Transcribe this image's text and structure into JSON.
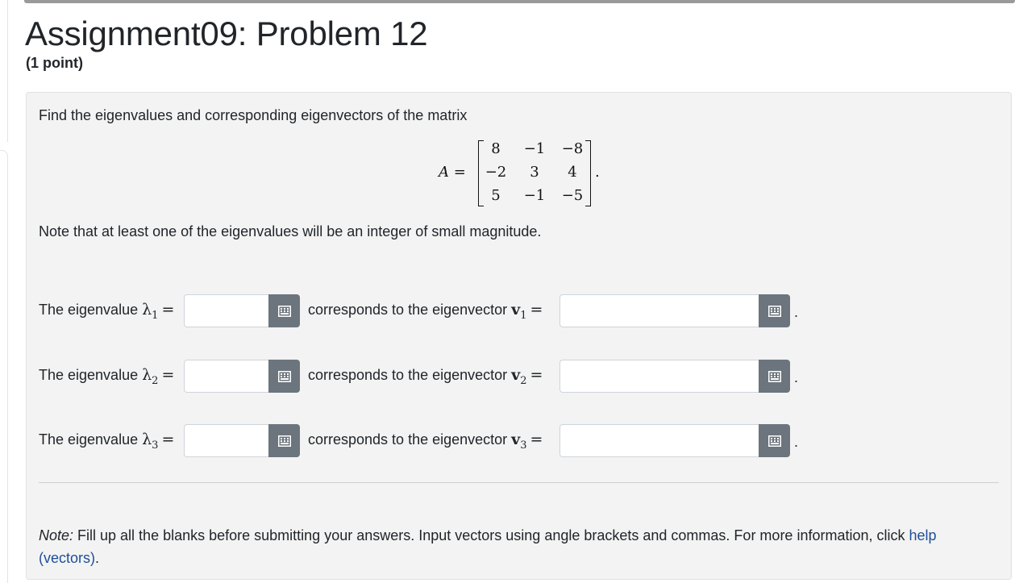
{
  "header": {
    "title": "Assignment09: Problem 12",
    "points": "(1 point)"
  },
  "problem": {
    "statement": "Find the eigenvalues and corresponding eigenvectors of the matrix",
    "matrix": {
      "name": "A",
      "eq": "=",
      "rows": [
        [
          "8",
          "−1",
          "−8"
        ],
        [
          "−2",
          "3",
          "4"
        ],
        [
          "5",
          "−1",
          "−5"
        ]
      ],
      "trailing": "."
    },
    "note": "Note that at least one of the eigenvalues will be an integer of small magnitude."
  },
  "answers": [
    {
      "eig_prefix": "The eigenvalue",
      "eig_sym": "λ",
      "index": "1",
      "eq": "=",
      "mid_text": "corresponds to the eigenvector",
      "vec_sym": "v",
      "period": ".",
      "eig_value": "",
      "vec_value": ""
    },
    {
      "eig_prefix": "The eigenvalue",
      "eig_sym": "λ",
      "index": "2",
      "eq": "=",
      "mid_text": "corresponds to the eigenvector",
      "vec_sym": "v",
      "period": ".",
      "eig_value": "",
      "vec_value": ""
    },
    {
      "eig_prefix": "The eigenvalue",
      "eig_sym": "λ",
      "index": "3",
      "eq": "=",
      "mid_text": "corresponds to the eigenvector",
      "vec_sym": "v",
      "period": ".",
      "eig_value": "",
      "vec_value": ""
    }
  ],
  "footnote": {
    "label": "Note:",
    "text": " Fill up all the blanks before submitting your answers. Input vectors using angle brackets and commas. For more information, click ",
    "link": "help (vectors)",
    "end": "."
  },
  "icons": {
    "equation_editor": "keyboard-grid-icon"
  },
  "colors": {
    "button_bg": "#6c757d",
    "panel_bg": "#f3f3f3",
    "link": "#1f4e96"
  }
}
